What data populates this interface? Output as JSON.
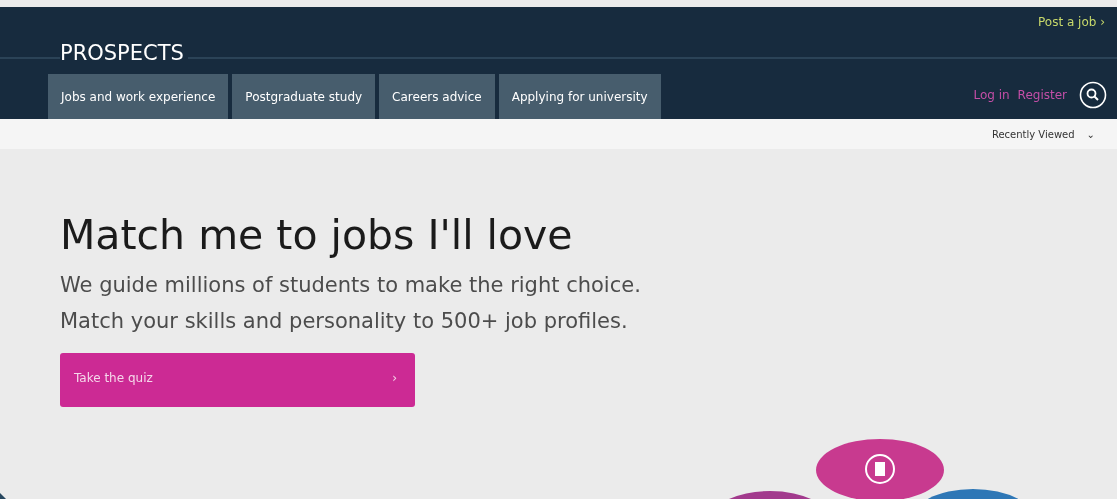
{
  "header": {
    "logo": "PROSPECTS",
    "post_job": "Post a job",
    "post_job_arrow": "›",
    "tabs": [
      {
        "label": "Jobs and work experience"
      },
      {
        "label": "Postgraduate study"
      },
      {
        "label": "Careers advice"
      },
      {
        "label": "Applying for university"
      }
    ],
    "login": "Log in",
    "register": "Register"
  },
  "subbar": {
    "recently_viewed": "Recently Viewed",
    "caret": "⌄"
  },
  "hero": {
    "title": "Match me to jobs I'll love",
    "lines": [
      "We guide millions of students to make the right choice.",
      "Match your skills and personality to 500+ job profiles."
    ],
    "button": {
      "label": "Take the quiz",
      "arrow": "›"
    }
  }
}
